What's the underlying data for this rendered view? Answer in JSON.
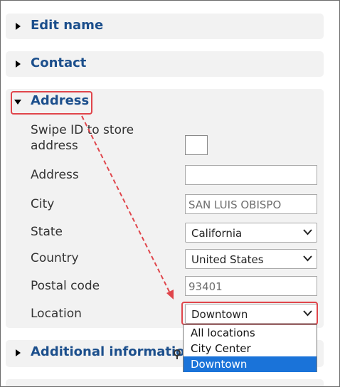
{
  "sections": {
    "edit_name": {
      "title": "Edit name"
    },
    "contact": {
      "title": "Contact"
    },
    "address": {
      "title": "Address"
    },
    "additional": {
      "title": "Additional information"
    }
  },
  "address_form": {
    "swipe_label": "Swipe ID to store address",
    "swipe_label_line1": "Swipe ID to store",
    "swipe_label_line2": "address",
    "address_label": "Address",
    "address_value": "",
    "city_label": "City",
    "city_value": "SAN LUIS OBISPO",
    "state_label": "State",
    "state_value": "California",
    "country_label": "Country",
    "country_value": "United States",
    "postal_label": "Postal code",
    "postal_value": "93401",
    "location_label": "Location",
    "location_value": "Downtown"
  },
  "location_options": [
    "All locations",
    "City Center",
    "Downtown"
  ],
  "location_selected_index": 2,
  "colors": {
    "section_title": "#1c4f8c",
    "highlight": "#e0454b",
    "option_selected": "#1a73d9",
    "section_bg": "#f2f2f2"
  },
  "icons": {
    "collapsed": "triangle-right-icon",
    "expanded": "triangle-down-icon",
    "select": "chevron-down-icon"
  }
}
